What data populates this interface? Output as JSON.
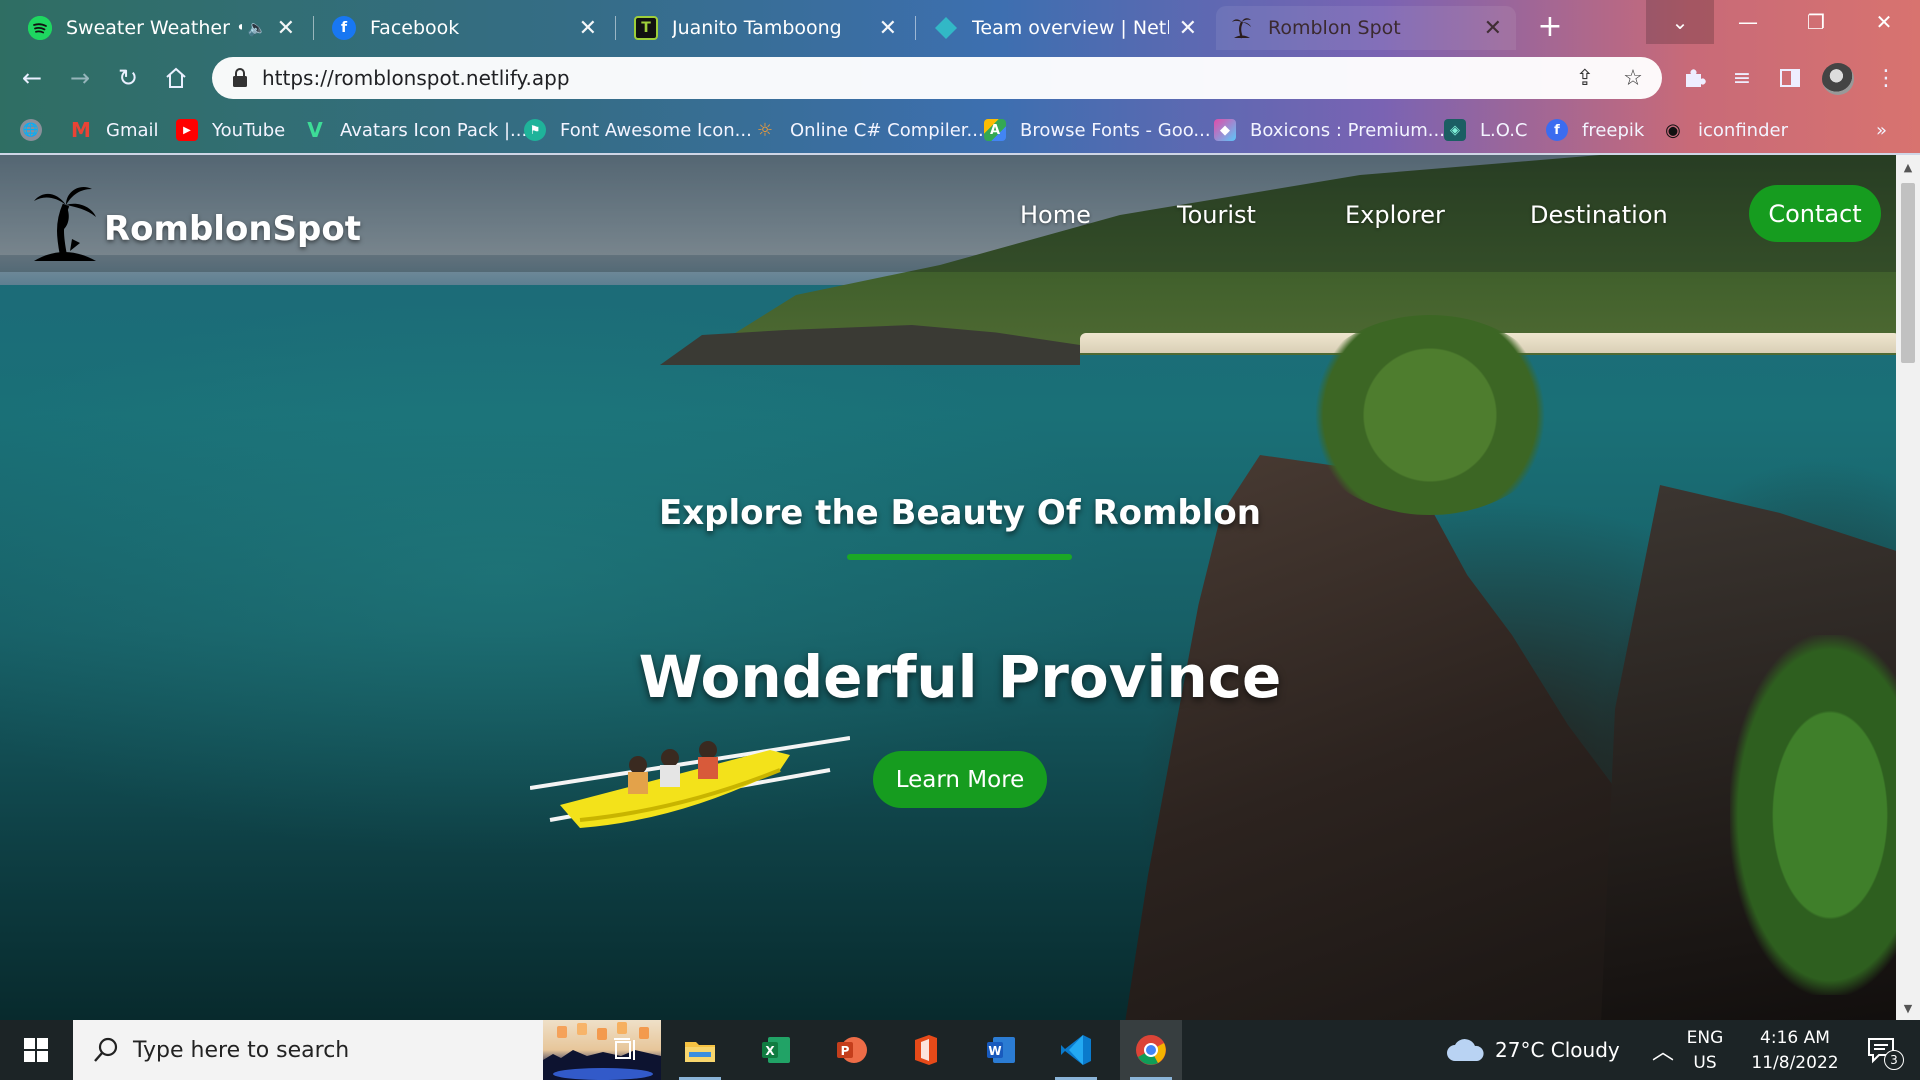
{
  "browser": {
    "tabs": [
      {
        "title": "Sweater Weather • Th",
        "icon": "spotify-icon",
        "audio": true,
        "active": false
      },
      {
        "title": "Facebook",
        "icon": "facebook-icon",
        "audio": false,
        "active": false
      },
      {
        "title": "Juanito Tamboong",
        "icon": "site-icon",
        "audio": false,
        "active": false
      },
      {
        "title": "Team overview | Netlify",
        "icon": "netlify-icon",
        "audio": false,
        "active": false
      },
      {
        "title": "Romblon Spot",
        "icon": "palm-tree-icon",
        "audio": false,
        "active": true
      }
    ],
    "url": "https://romblonspot.netlify.app",
    "bookmarks": [
      {
        "label": "Gmail",
        "icon": "gmail-icon",
        "color": "#ea4335"
      },
      {
        "label": "YouTube",
        "icon": "youtube-icon",
        "color": "#ff0000"
      },
      {
        "label": "Avatars Icon Pack |...",
        "icon": "avatars-icon",
        "color": "#3ddc97"
      },
      {
        "label": "Font Awesome Icon...",
        "icon": "font-awesome-icon",
        "color": "#1fb39a"
      },
      {
        "label": "Online C# Compiler...",
        "icon": "compiler-icon",
        "color": "#f29d38"
      },
      {
        "label": "Browse Fonts - Goo...",
        "icon": "google-fonts-icon",
        "color": "#4285f4"
      },
      {
        "label": "Boxicons : Premium...",
        "icon": "boxicons-icon",
        "color": "#e24ba8"
      },
      {
        "label": "L.O.C",
        "icon": "loc-icon",
        "color": "#1b5e63"
      },
      {
        "label": "freepik",
        "icon": "freepik-icon",
        "color": "#3b6cf0"
      },
      {
        "label": "iconfinder",
        "icon": "iconfinder-icon",
        "color": "#222222"
      }
    ],
    "overflow_label": "»"
  },
  "site": {
    "logo_text": "RomblonSpot",
    "nav": [
      "Home",
      "Tourist",
      "Explorer",
      "Destination"
    ],
    "contact_label": "Contact",
    "hero_subtitle": "Explore the Beauty Of Romblon",
    "hero_title": "Wonderful Province",
    "cta_label": "Learn More",
    "accent_color": "#169c1f"
  },
  "taskbar": {
    "search_placeholder": "Type here to search",
    "apps": [
      "task-view-icon",
      "file-explorer-icon",
      "excel-icon",
      "powerpoint-icon",
      "office-icon",
      "word-icon",
      "vscode-icon",
      "chrome-icon"
    ],
    "weather": "27°C  Cloudy",
    "lang_line1": "ENG",
    "lang_line2": "US",
    "time": "4:16 AM",
    "date": "11/8/2022",
    "notification_count": "3"
  }
}
